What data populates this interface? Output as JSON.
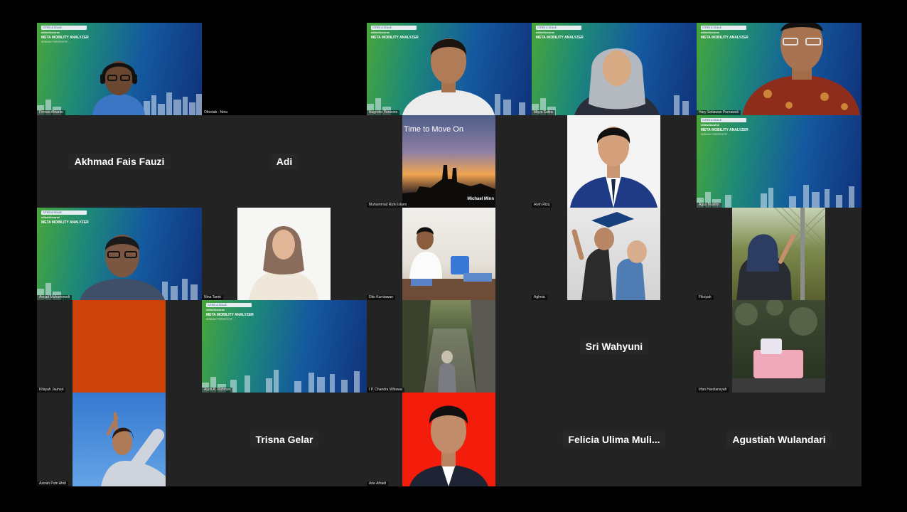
{
  "conference_bg": {
    "logo_text": "CITIES & SCALE",
    "series_text": "citiesXcourse",
    "title_text": "META MOBILITY ANALYZER",
    "tagline_text": "SEBUAH PERSPEKTIF ...",
    "sub_text": "..."
  },
  "participants": [
    {
      "name": "Firman Afrianto",
      "type": "conf"
    },
    {
      "name": "Otieslab - Nina",
      "type": "black"
    },
    {
      "name": "Nugroho Purwono",
      "type": "conf"
    },
    {
      "name": "Maya Safira",
      "type": "conf"
    },
    {
      "name": "Hary Setiawan Purnawali",
      "type": "conf"
    },
    {
      "name": "Akhmad Fais Fauzi",
      "type": "text"
    },
    {
      "name": "Adi",
      "type": "text"
    },
    {
      "name": "Muhammad Rizki Islami",
      "type": "photo",
      "photo_caption": "Time to Move On",
      "photo_credit": "Michael Minn"
    },
    {
      "name": "Alvin Rizq",
      "type": "photo"
    },
    {
      "name": "Agus Muslim",
      "type": "conf"
    },
    {
      "name": "Amjad Muhammedi",
      "type": "conf"
    },
    {
      "name": "Nina Tantri",
      "type": "photo"
    },
    {
      "name": "Dito Kurniawan",
      "type": "photo"
    },
    {
      "name": "Aghnia",
      "type": "photo"
    },
    {
      "name": "Fikriyah",
      "type": "photo"
    },
    {
      "name": "Kifayah Jauhari",
      "type": "photo"
    },
    {
      "name": "Ayub A. Rahman",
      "type": "conf"
    },
    {
      "name": "I P. Chandra Wibawa",
      "type": "photo"
    },
    {
      "name": "Sri Wahyuni",
      "type": "text"
    },
    {
      "name": "Irfan Hardiansyah",
      "type": "photo"
    },
    {
      "name": "Azizah Putri Abdi",
      "type": "photo"
    },
    {
      "name": "Trisna Gelar",
      "type": "text"
    },
    {
      "name": "Arie Afriadi",
      "type": "photo"
    },
    {
      "name": "Felicia Ulima Muli...",
      "type": "text"
    },
    {
      "name": "Agustiah Wulandari",
      "type": "text"
    }
  ],
  "colors": {
    "background": "#000000",
    "tile": "#232323",
    "conf_green": "#48a63a",
    "conf_blue": "#10327a",
    "orange": "#cc4208",
    "red": "#f41d0c"
  }
}
